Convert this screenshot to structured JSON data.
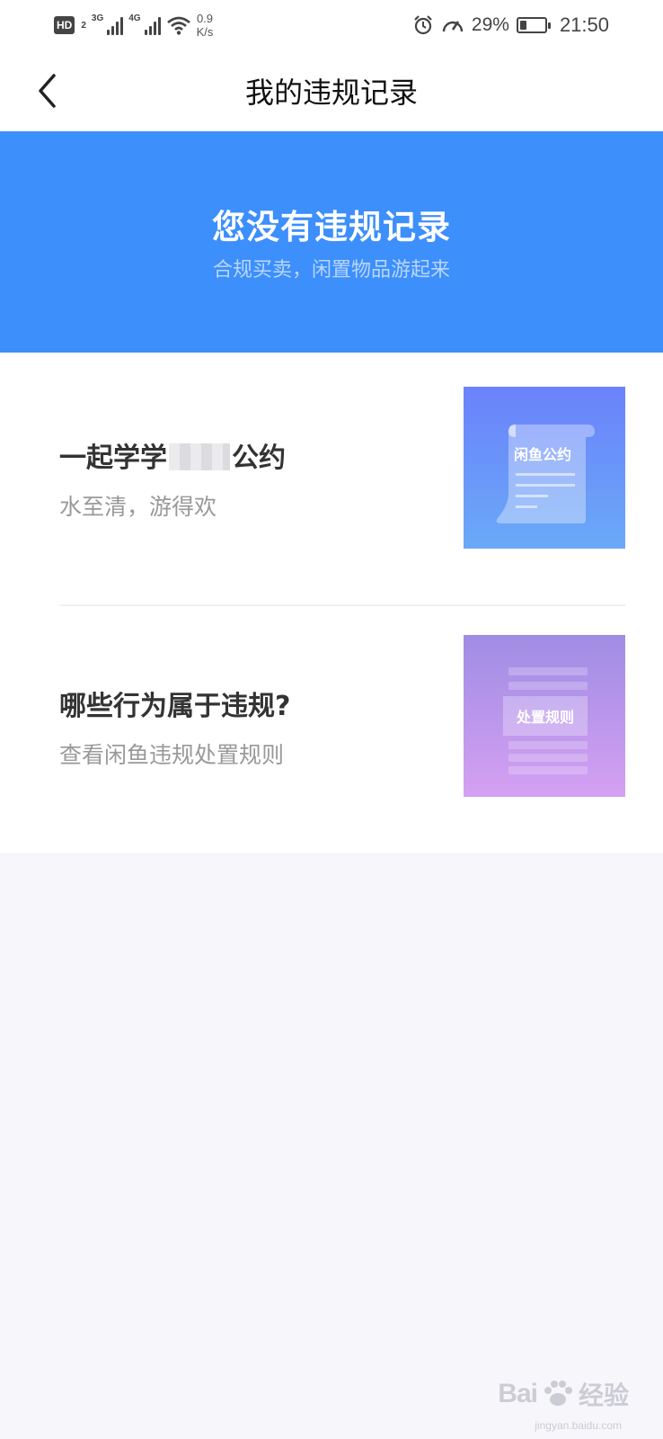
{
  "status_bar": {
    "hd_label": "HD",
    "hd_sub": "2",
    "net1": "3G",
    "net2": "4G",
    "speed_value": "0.9",
    "speed_unit": "K/s",
    "battery_percent": "29%",
    "battery_level": 0.29,
    "time": "21:50"
  },
  "nav": {
    "title": "我的违规记录"
  },
  "banner": {
    "title": "您没有违规记录",
    "subtitle": "合规买卖，闲置物品游起来",
    "background": "#3d8ffb"
  },
  "cards": [
    {
      "title_prefix": "一起学学",
      "title_suffix": "公约",
      "description": "水至清，游得欢",
      "thumb_label": "闲鱼公约",
      "thumb_icon": "scroll-document-icon"
    },
    {
      "title": "哪些行为属于违规?",
      "description": "查看闲鱼违规处置规则",
      "thumb_label": "处置规则",
      "thumb_icon": "rules-document-icon"
    }
  ],
  "watermark": {
    "brand": "Bai",
    "brand_cn": "经验",
    "url": "jingyan.baidu.com"
  }
}
